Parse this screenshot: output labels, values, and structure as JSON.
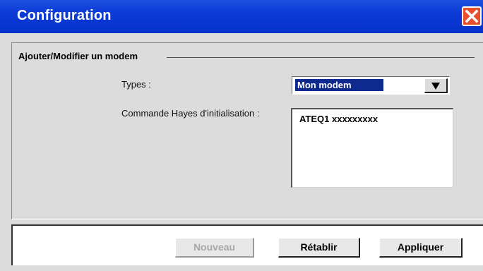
{
  "window": {
    "title": "Configuration",
    "close_icon": "close-icon"
  },
  "group": {
    "label": "Ajouter/Modifier un modem"
  },
  "form": {
    "types_label": "Types :",
    "types_value": "Mon modem",
    "hayes_label": "Commande Hayes d'initialisation :",
    "hayes_value": "ATEQ1 xxxxxxxxx"
  },
  "buttons": {
    "new_label": "Nouveau",
    "reset_label": "Rétablir",
    "apply_label": "Appliquer"
  },
  "colors": {
    "titlebar": "#0b3ad6",
    "close_button": "#e8502d",
    "selection": "#0f2a8f"
  }
}
